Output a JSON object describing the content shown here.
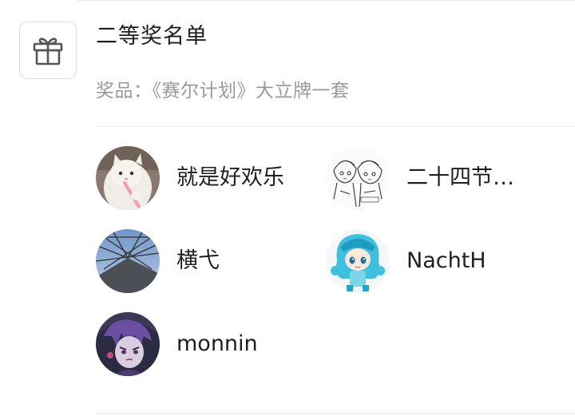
{
  "prize": {
    "title": "二等奖名单",
    "description": "奖品：《赛尔计划》大立牌一套",
    "icon": "gift-icon"
  },
  "winners": [
    {
      "name": "就是好欢乐",
      "avatar": "cat-toothbrush-avatar"
    },
    {
      "name": "二十四节…",
      "avatar": "sketch-girls-avatar"
    },
    {
      "name": "横弋",
      "avatar": "glass-roof-avatar"
    },
    {
      "name": "NachtH",
      "avatar": "blue-hair-chibi-avatar"
    },
    {
      "name": "monnin",
      "avatar": "anime-character-avatar"
    }
  ]
}
